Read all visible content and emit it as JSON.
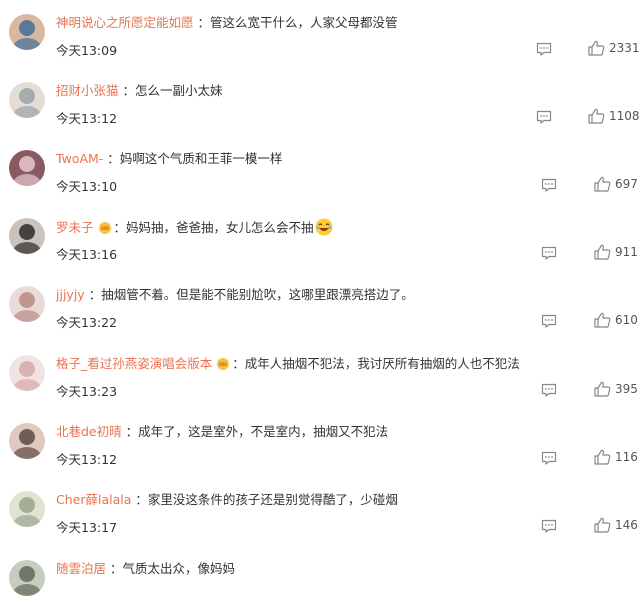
{
  "comments": [
    {
      "user": "神明说心之所愿定能如愿",
      "badge": false,
      "text": "管这么宽干什么，人家父母都没管",
      "emoji": false,
      "time": "今天13:09",
      "likes": "2331"
    },
    {
      "user": "招财小张猫",
      "badge": false,
      "text": "怎么一副小太妹",
      "emoji": false,
      "time": "今天13:12",
      "likes": "1108"
    },
    {
      "user": "TwoAM-",
      "badge": false,
      "text": "妈啊这个气质和王菲一模一样",
      "emoji": false,
      "time": "今天13:10",
      "likes": "697"
    },
    {
      "user": "罗未子",
      "badge": true,
      "text": "妈妈抽，爸爸抽，女儿怎么会不抽",
      "emoji": true,
      "time": "今天13:16",
      "likes": "911"
    },
    {
      "user": "jjjyjy",
      "badge": false,
      "text": "抽烟管不着。但是能不能别尬吹，这哪里跟漂亮搭边了。",
      "emoji": false,
      "time": "今天13:22",
      "likes": "610"
    },
    {
      "user": "格子_看过孙燕姿演唱会版本",
      "badge": true,
      "text": "成年人抽烟不犯法，我讨厌所有抽烟的人也不犯法",
      "emoji": false,
      "time": "今天13:23",
      "likes": "395"
    },
    {
      "user": "北巷de初晴",
      "badge": false,
      "text": "成年了，这是室外，不是室内，抽烟又不犯法",
      "emoji": false,
      "time": "今天13:12",
      "likes": "116"
    },
    {
      "user": "Cher薛lalala",
      "badge": false,
      "text": "家里没这条件的孩子还是别觉得酷了，少碰烟",
      "emoji": false,
      "time": "今天13:17",
      "likes": "146"
    },
    {
      "user": "随雲泊居",
      "badge": false,
      "text": "气质太出众，像妈妈",
      "emoji": false,
      "time": "",
      "likes": ""
    }
  ],
  "separator": "：",
  "icons": {
    "comment": "comment-icon",
    "like": "thumbs-up-icon",
    "badge": "crown-badge-icon",
    "emoji": "laughing-emoji-icon"
  },
  "colors": {
    "username": "#eb7350",
    "text": "#333333",
    "icon": "#888888"
  }
}
